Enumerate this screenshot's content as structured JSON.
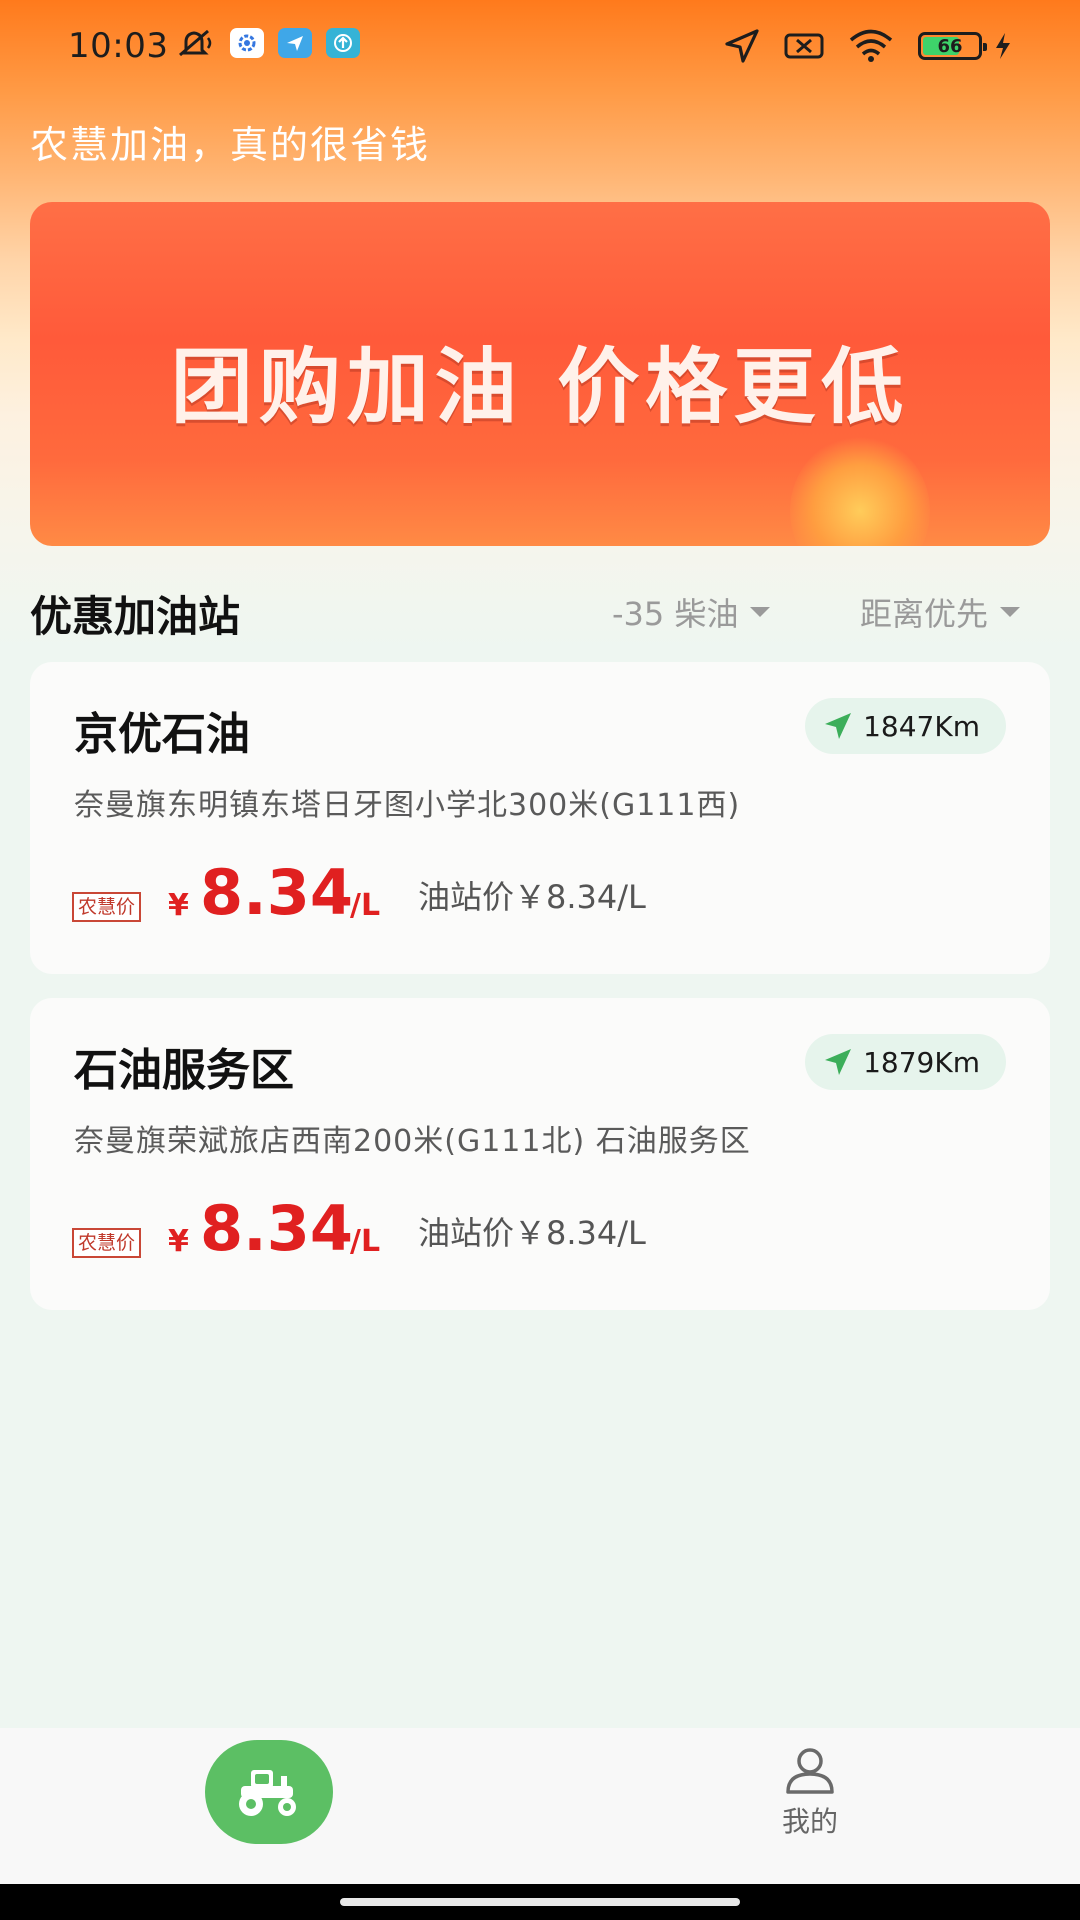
{
  "status_bar": {
    "time": "10:03",
    "battery_level": "66",
    "icons": [
      "mute-icon",
      "settings-app-icon",
      "paper-plane-app-icon",
      "upload-app-icon",
      "location-icon",
      "no-sim-icon",
      "wifi-icon",
      "battery-icon",
      "charging-icon"
    ]
  },
  "header": {
    "tagline": "农慧加油，真的很省钱"
  },
  "banner": {
    "text": "团购加油 价格更低"
  },
  "section": {
    "title": "优惠加油站",
    "fuel_filter": "-35 柴油",
    "sort_filter": "距离优先"
  },
  "stations": [
    {
      "name": "京优石油",
      "distance": "1847Km",
      "address": "奈曼旗东明镇东塔日牙图小学北300米(G111西)",
      "tag": "农慧价",
      "yen": "¥",
      "price": "8.34",
      "unit": "/L",
      "station_price": "油站价￥8.34/L"
    },
    {
      "name": "石油服务区",
      "distance": "1879Km",
      "address": "奈曼旗荣斌旅店西南200米(G111北) 石油服务区",
      "tag": "农慧价",
      "yen": "¥",
      "price": "8.34",
      "unit": "/L",
      "station_price": "油站价￥8.34/L"
    }
  ],
  "tabbar": {
    "home_icon": "tractor-icon",
    "mine_label": "我的",
    "mine_icon": "person-icon"
  },
  "colors": {
    "accent_red": "#e02020",
    "accent_green": "#5cbf64",
    "header_orange": "#ff7a1c"
  }
}
